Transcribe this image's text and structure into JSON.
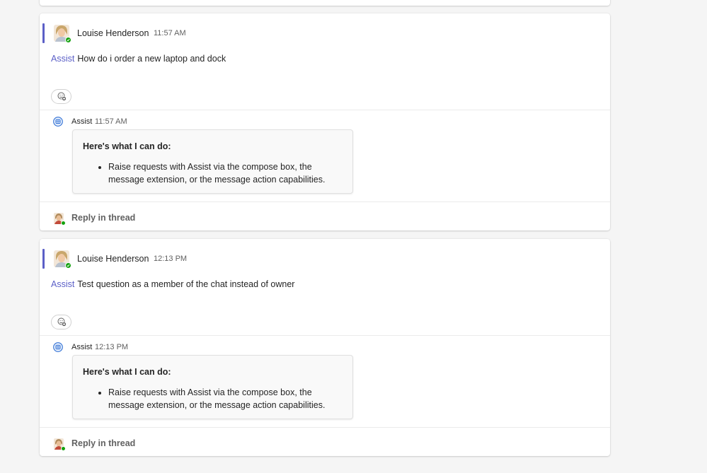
{
  "messages": [
    {
      "author": "Louise Henderson",
      "time": "11:57 AM",
      "mention": "Assist",
      "text": "How do i order a new laptop and dock",
      "bot": {
        "name": "Assist",
        "time": "11:57 AM",
        "card_title": "Here's what I can do:",
        "card_items": [
          "Raise requests with Assist via the compose box, the message extension, or the message action capabilities."
        ]
      },
      "reply_label": "Reply in thread"
    },
    {
      "author": "Louise Henderson",
      "time": "12:13 PM",
      "mention": "Assist",
      "text": "Test question as a member of the chat instead of owner",
      "bot": {
        "name": "Assist",
        "time": "12:13 PM",
        "card_title": "Here's what I can do:",
        "card_items": [
          "Raise requests with Assist via the compose box, the message extension, or the message action capabilities."
        ]
      },
      "reply_label": "Reply in thread"
    }
  ],
  "icons": {
    "avatar": "user-avatar",
    "presence": "available-presence-icon",
    "reaction": "add-reaction-icon",
    "bot": "assist-bot-icon"
  },
  "colors": {
    "accent": "#5b5fc7",
    "presence_available": "#13a10e",
    "bot_icon": "#2f6fd4"
  }
}
